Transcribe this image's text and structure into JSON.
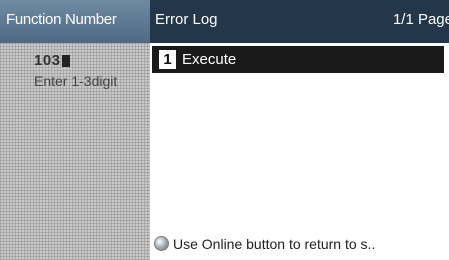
{
  "function_panel": {
    "title": "Function Number",
    "value": "103",
    "hint": "Enter 1-3digit"
  },
  "header": {
    "title": "Error Log",
    "page_indicator": "1/1 Page"
  },
  "items": [
    {
      "number": "1",
      "label": "Execute"
    }
  ],
  "footer": {
    "text": "Use Online button to return to s.."
  },
  "icons": {
    "online": "online-button-icon"
  }
}
